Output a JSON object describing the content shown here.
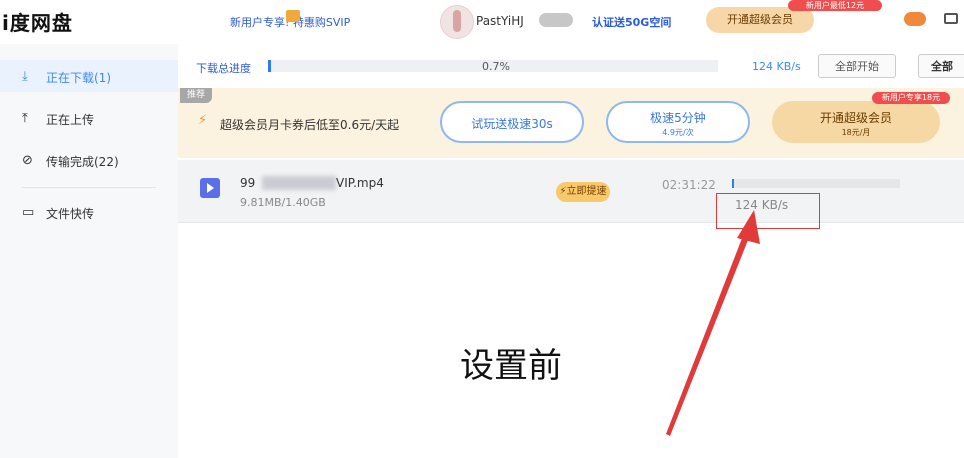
{
  "app": {
    "logo": "i度网盘"
  },
  "topbar": {
    "promo": "新用户专享! 特惠购SVIP",
    "username": "PastYiHJ",
    "verify": "认证送50G空间",
    "vip_button": "开通超级会员",
    "vip_badge": "新用户最低12元"
  },
  "sidebar": {
    "items": [
      {
        "label": "正在下载(1)",
        "icon": "download-icon"
      },
      {
        "label": "正在上传",
        "icon": "upload-icon"
      },
      {
        "label": "传输完成(22)",
        "icon": "check-circle-icon"
      },
      {
        "label": "文件快传",
        "icon": "monitor-icon"
      }
    ]
  },
  "progress": {
    "label": "下载总进度",
    "percent_text": "0.7%",
    "percent": 0.007,
    "speed": "124 KB/s",
    "start_all": "全部开始",
    "all_more": "全部"
  },
  "promo_band": {
    "tag": "推荐",
    "text": "超级会员月卡券后低至0.6元/天起",
    "trial_button": "试玩送极速30s",
    "speed_button": "极速5分钟",
    "speed_price": "4.9元/次",
    "vip_button": "开通超级会员",
    "vip_price": "18元/月",
    "vip_badge": "新用户专享18元"
  },
  "download": {
    "name_prefix": "99",
    "name_suffix": "VIP.mp4",
    "size": "9.81MB/1.40GB",
    "boost": "立即提速",
    "time": "02:31:22",
    "speed": "124 KB/s",
    "percent": 0.007
  },
  "annotation": {
    "caption": "设置前",
    "color": "#e03a3a"
  }
}
